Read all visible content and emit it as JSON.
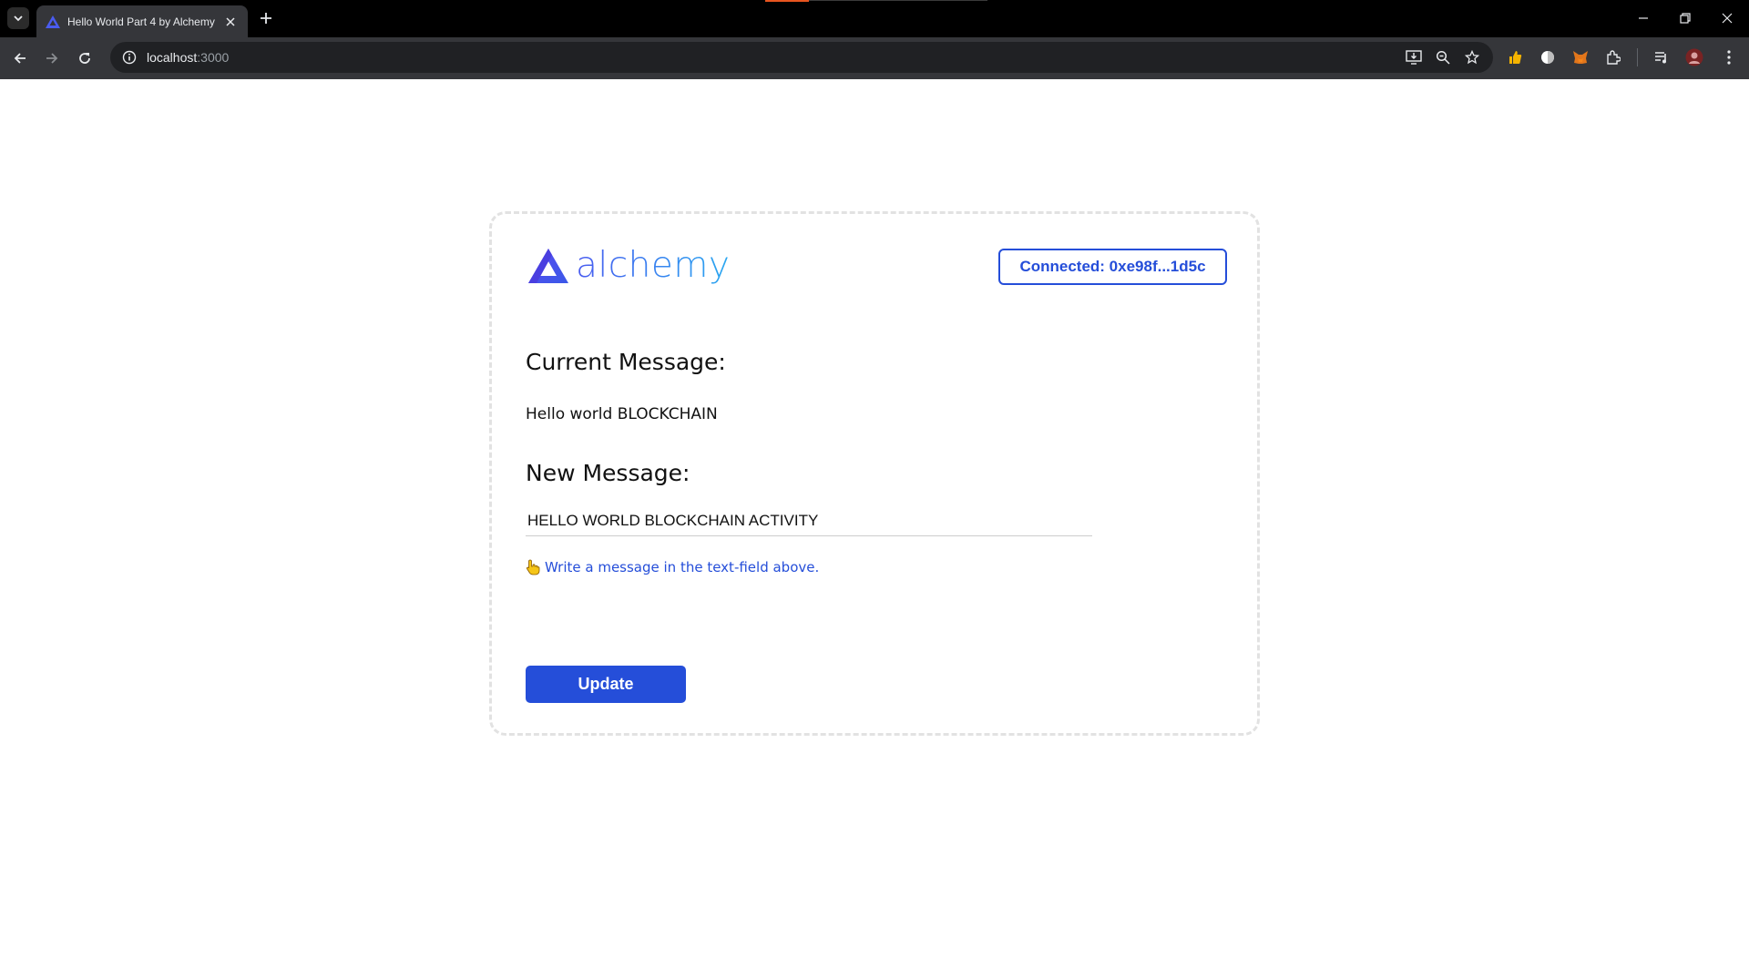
{
  "browser": {
    "tab_title": "Hello World Part 4 by Alchemy",
    "url_host": "localhost",
    "url_port": ":3000",
    "icons": [
      "tab-search-icon",
      "alchemy-favicon",
      "close-icon",
      "plus-icon",
      "minimize-icon",
      "restore-icon",
      "close-window-icon",
      "back-arrow-icon",
      "forward-arrow-icon",
      "reload-icon",
      "site-info-icon",
      "install-app-icon",
      "zoom-icon",
      "bookmark-star-icon",
      "extensions-icon",
      "media-icon",
      "profile-avatar-icon",
      "menu-dots-icon"
    ]
  },
  "app": {
    "logo_text": "alchemy",
    "wallet_label": "Connected: 0xe98f...1d5c",
    "current_heading": "Current Message:",
    "current_message": "Hello world BLOCKCHAIN",
    "new_heading": "New Message:",
    "input_value": "HELLO WORLD BLOCKCHAIN ACTIVITY",
    "status": "Write a message in the text-field above.",
    "update_label": "Update"
  },
  "colors": {
    "primary": "#254ed9",
    "card_border": "#e2e2e2",
    "chrome_dark": "#35363a"
  }
}
